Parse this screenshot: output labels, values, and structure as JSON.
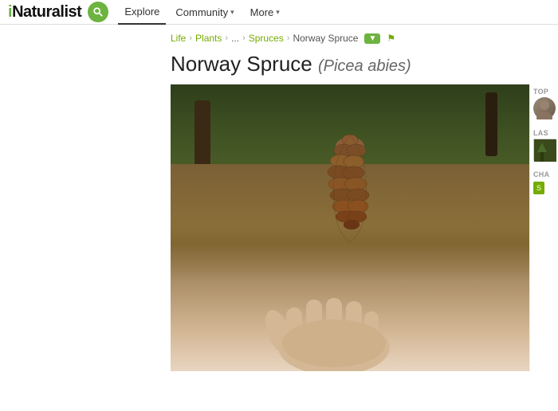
{
  "header": {
    "logo_i": "i",
    "logo_naturalist": "Naturalist",
    "nav_items": [
      {
        "label": "Explore",
        "active": true,
        "has_dropdown": false
      },
      {
        "label": "Community",
        "active": false,
        "has_dropdown": true
      },
      {
        "label": "More",
        "active": false,
        "has_dropdown": true
      }
    ]
  },
  "breadcrumb": {
    "life": "Life",
    "ellipsis": "...",
    "plants": "Plants",
    "spruces": "Spruces",
    "current": "Norway Spruce",
    "flag_tooltip": "flag"
  },
  "page_title": {
    "common_name": "Norway Spruce",
    "scientific_name": "(Picea abies)"
  },
  "right_panel": {
    "top_observers_label": "TOP",
    "last_obs_label": "LAS",
    "charts_label": "CHA",
    "see_button": "S"
  }
}
